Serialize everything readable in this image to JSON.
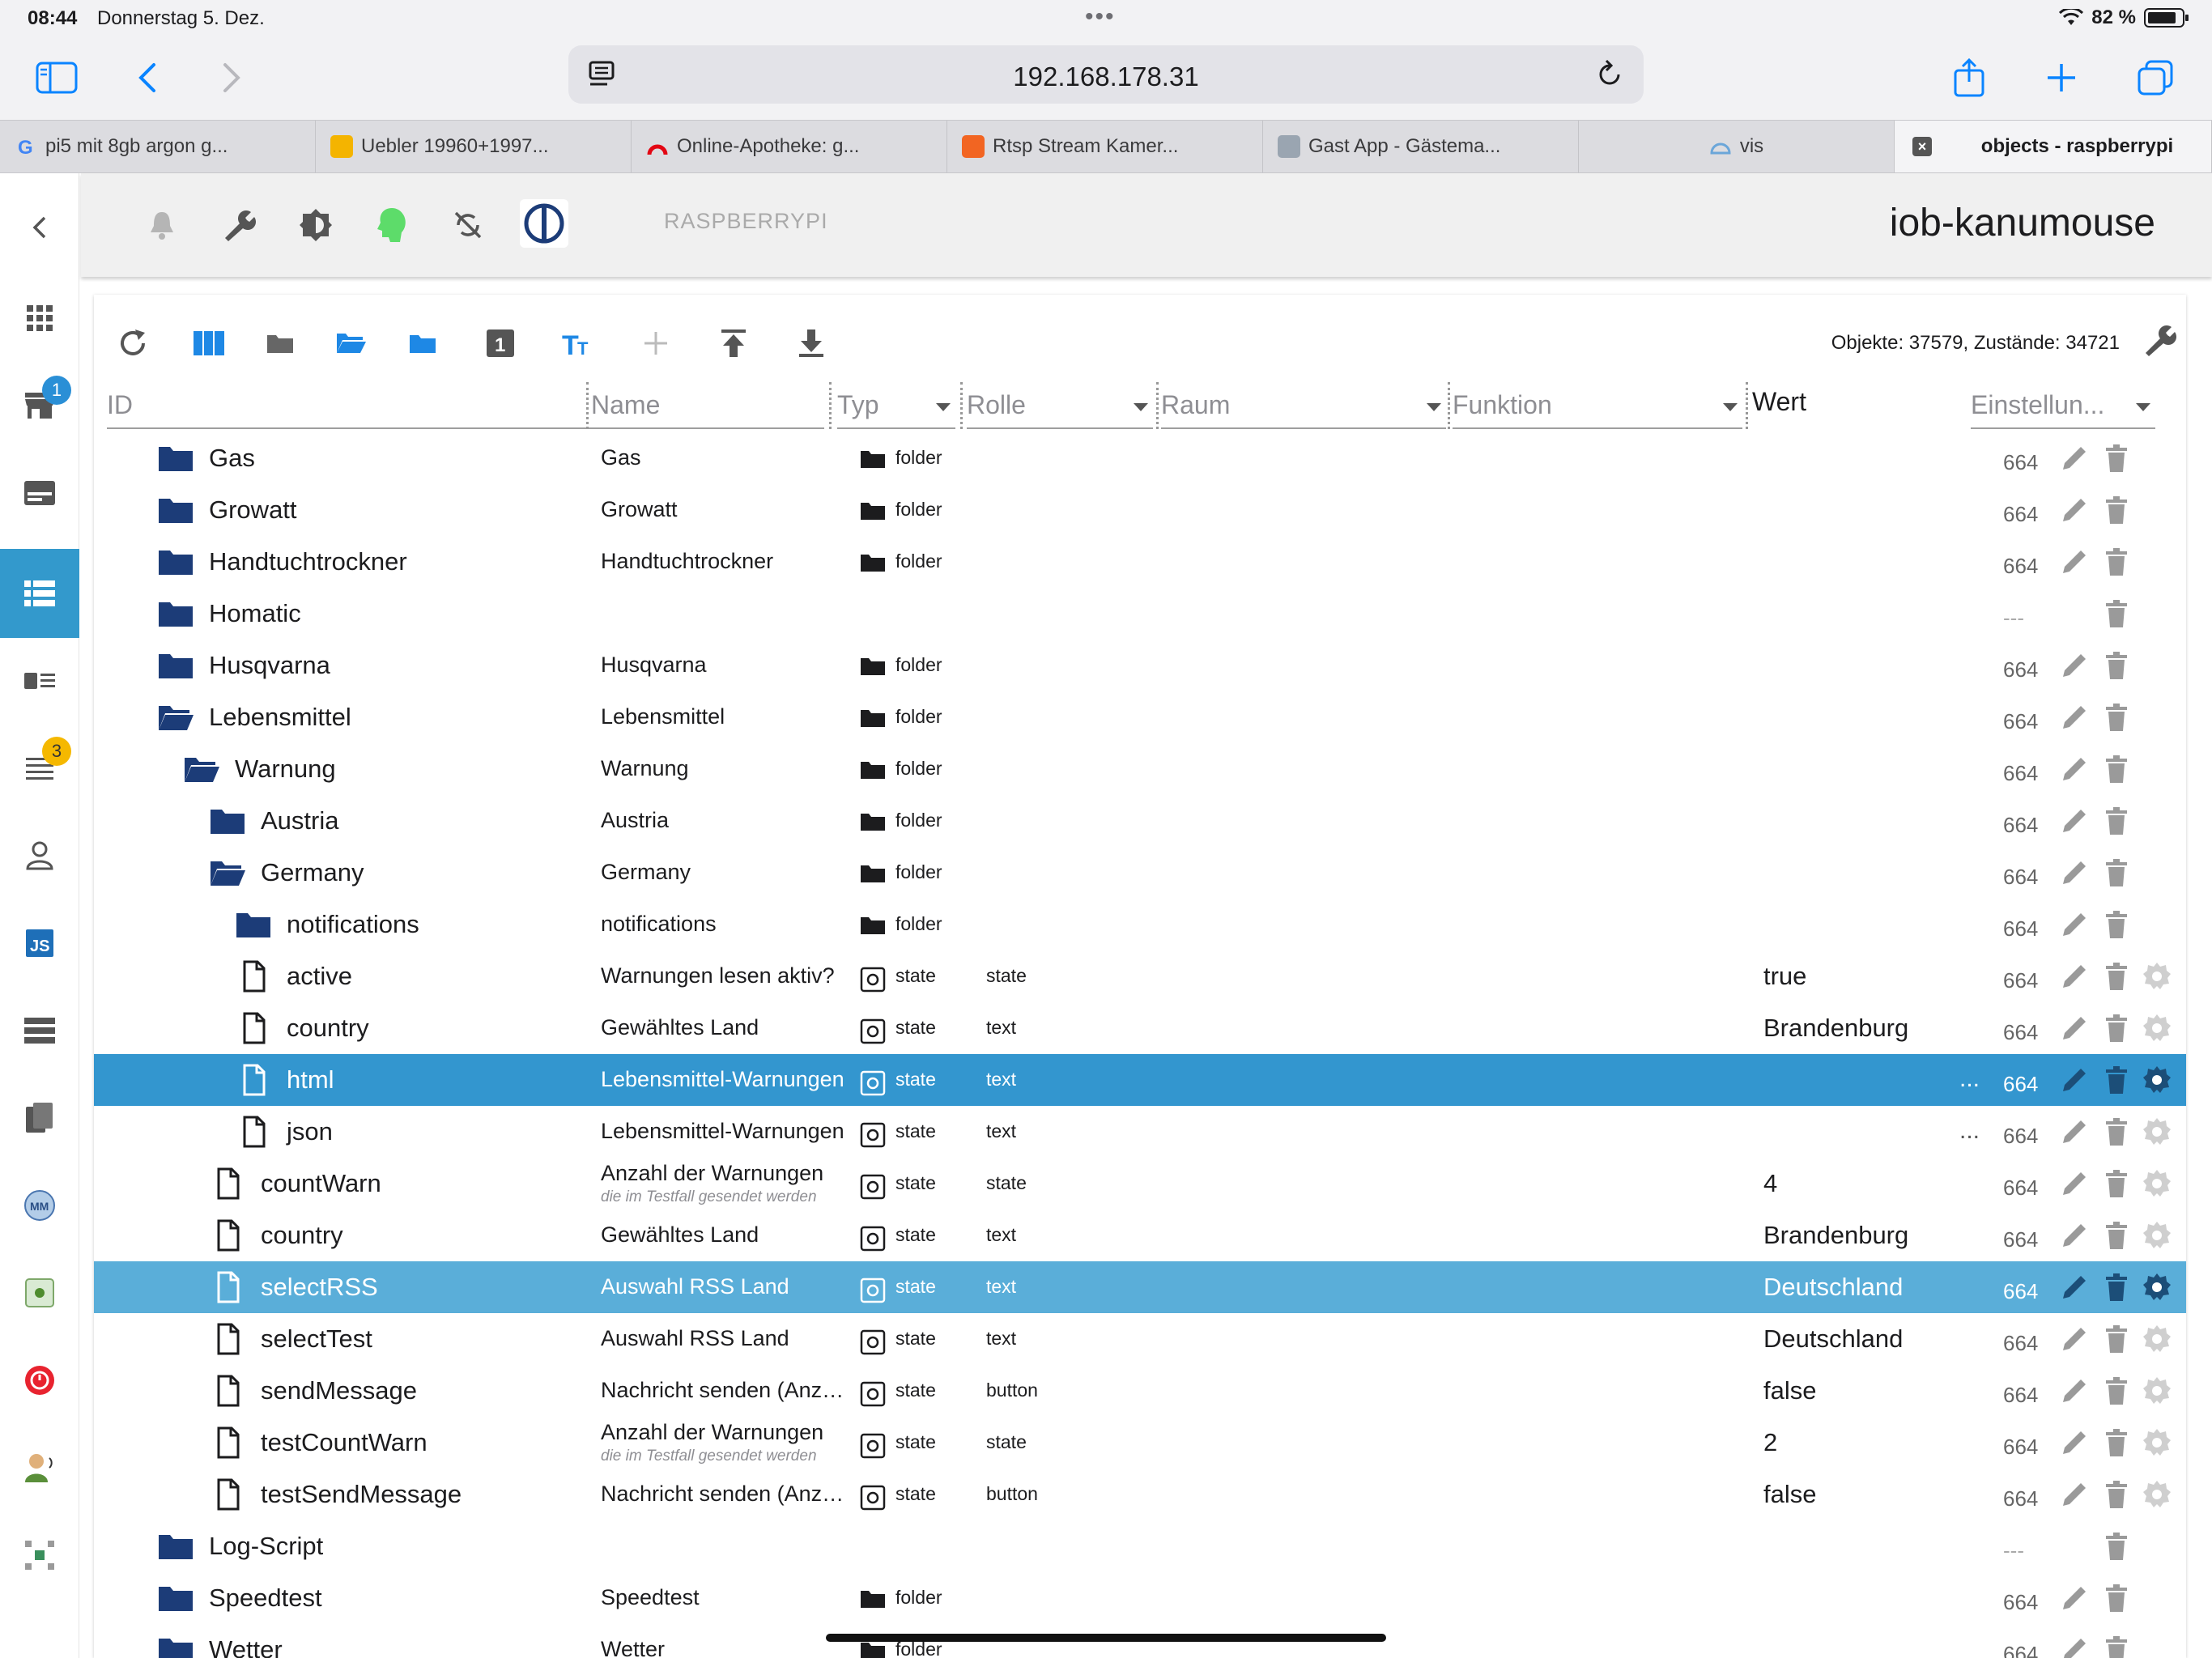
{
  "status": {
    "time": "08:44",
    "date": "Donnerstag 5. Dez.",
    "battery": "82 %"
  },
  "browser": {
    "url": "192.168.178.31"
  },
  "tabs": [
    {
      "label": "pi5 mit 8gb argon g...",
      "fav_color": "#ffffff"
    },
    {
      "label": "Uebler 19960+1997...",
      "fav_color": "#f4b400"
    },
    {
      "label": "Online-Apotheke: g...",
      "fav_color": "#e30613"
    },
    {
      "label": "Rtsp Stream Kamer...",
      "fav_color": "#f26522"
    },
    {
      "label": "Gast App - Gästema...",
      "fav_color": "#9aa5b1"
    },
    {
      "label": "vis",
      "fav_color": "#6ba6d9"
    },
    {
      "label": "objects - raspberrypi",
      "close": "×"
    }
  ],
  "header": {
    "host_label": "RASPBERRYPI",
    "title": "iob-kanumouse"
  },
  "sidebar": {
    "badges": {
      "adapters": "1",
      "logs": "3"
    }
  },
  "objects_toolbar": {
    "counts": "Objekte: 37579, Zustände: 34721"
  },
  "columns": {
    "id": "ID",
    "name": "Name",
    "type": "Typ",
    "role": "Rolle",
    "room": "Raum",
    "function": "Funktion",
    "value": "Wert",
    "settings": "Einstellun..."
  },
  "rows": [
    {
      "id": "Gas",
      "name": "Gas",
      "type": "folder",
      "perm": "664"
    },
    {
      "id": "Growatt",
      "name": "Growatt",
      "type": "folder",
      "perm": "664"
    },
    {
      "id": "Handtuchtrockner",
      "name": "Handtuchtrockner",
      "type": "folder",
      "perm": "664"
    },
    {
      "id": "Homatic",
      "perm": "---"
    },
    {
      "id": "Husqvarna",
      "name": "Husqvarna",
      "type": "folder",
      "perm": "664"
    },
    {
      "id": "Lebensmittel",
      "name": "Lebensmittel",
      "type": "folder",
      "perm": "664"
    },
    {
      "id": "Warnung",
      "name": "Warnung",
      "type": "folder",
      "perm": "664"
    },
    {
      "id": "Austria",
      "name": "Austria",
      "type": "folder",
      "perm": "664"
    },
    {
      "id": "Germany",
      "name": "Germany",
      "type": "folder",
      "perm": "664"
    },
    {
      "id": "notifications",
      "name": "notifications",
      "type": "folder",
      "perm": "664"
    },
    {
      "id": "active",
      "name": "Warnungen lesen aktiv?",
      "type": "state",
      "role": "state",
      "value": "true",
      "perm": "664"
    },
    {
      "id": "country",
      "name": "Gewähltes Land",
      "type": "state",
      "role": "text",
      "value": "Brandenburg",
      "perm": "664"
    },
    {
      "id": "html",
      "name": "Lebensmittel-Warnungen",
      "type": "state",
      "role": "text",
      "ellipsis": "...",
      "perm": "664"
    },
    {
      "id": "json",
      "name": "Lebensmittel-Warnungen",
      "type": "state",
      "role": "text",
      "ellipsis": "...",
      "perm": "664"
    },
    {
      "id": "countWarn",
      "name": "Anzahl der Warnungen",
      "sub": "die im Testfall gesendet werden",
      "type": "state",
      "role": "state",
      "value": "4",
      "perm": "664"
    },
    {
      "id": "country",
      "name": "Gewähltes Land",
      "type": "state",
      "role": "text",
      "value": "Brandenburg",
      "perm": "664"
    },
    {
      "id": "selectRSS",
      "name": "Auswahl RSS Land",
      "type": "state",
      "role": "text",
      "value": "Deutschland",
      "perm": "664"
    },
    {
      "id": "selectTest",
      "name": "Auswahl RSS Land",
      "type": "state",
      "role": "text",
      "value": "Deutschland",
      "perm": "664"
    },
    {
      "id": "sendMessage",
      "name": "Nachricht senden (Anzahl)",
      "type": "state",
      "role": "button",
      "value": "false",
      "perm": "664"
    },
    {
      "id": "testCountWarn",
      "name": "Anzahl der Warnungen",
      "sub": "die im Testfall gesendet werden",
      "type": "state",
      "role": "state",
      "value": "2",
      "perm": "664"
    },
    {
      "id": "testSendMessage",
      "name": "Nachricht senden (Anzahl)",
      "type": "state",
      "role": "button",
      "value": "false",
      "perm": "664"
    },
    {
      "id": "Log-Script",
      "perm": "---"
    },
    {
      "id": "Speedtest",
      "name": "Speedtest",
      "type": "folder",
      "perm": "664"
    },
    {
      "id": "Wetter",
      "name": "Wetter",
      "type": "folder",
      "perm": "664"
    }
  ]
}
